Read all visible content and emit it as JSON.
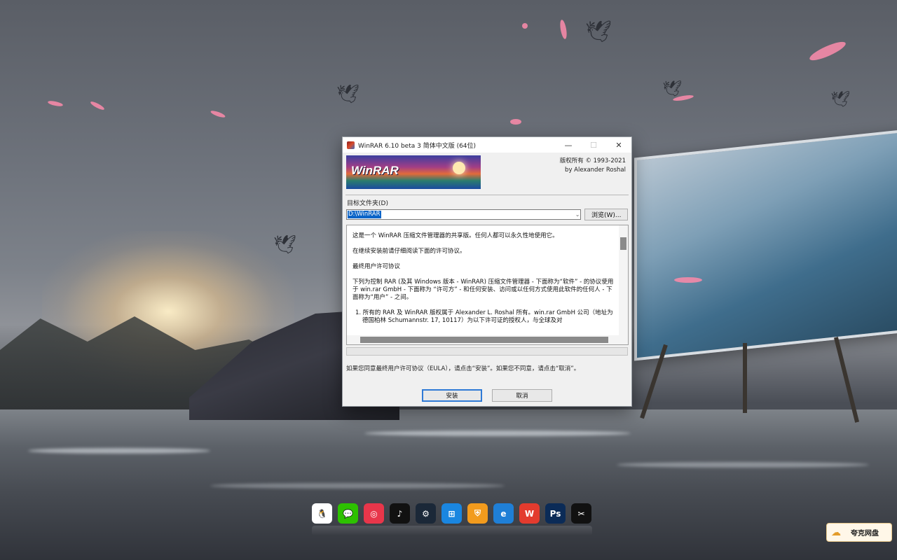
{
  "dialog": {
    "title": "WinRAR 6.10 beta 3 简体中文版 (64位)",
    "buttons": {
      "minimize": "—",
      "maximize": "☐",
      "close": "✕"
    },
    "banner_logo": "WinRAR",
    "copyright_line1": "版权所有 © 1993-2021",
    "copyright_line2": "by Alexander Roshal",
    "folder_label": "目标文件夹(D)",
    "folder_value": "D:\\WinRAR",
    "browse_label": "浏览(W)...",
    "license": {
      "p1": "这是一个 WinRAR 压缩文件管理器的共享版。任何人都可以永久性地使用它。",
      "p2": "在继续安装前请仔细阅读下面的许可协议。",
      "p3": "最终用户许可协议",
      "p4": "下列为控制 RAR (及其 Windows 版本 - WinRAR) 压缩文件管理器 - 下面称为“软件” - 的协议使用于 win.rar GmbH - 下面称为 “许可方” - 和任何安装、访问或以任何方式使用此软件的任何人 - 下面称为“用户” - 之间。",
      "p5": "1.   所有的 RAR 及 WinRAR 版权属于 Alexander L. Roshal 所有。win.rar GmbH 公司（地址为德国柏林 Schumannstr. 17, 10117）为以下许可证的授权人，与全球及对"
    },
    "hint": "如果您同意最终用户许可协议（EULA），请点击“安装”。如果您不同意，请点击“取消”。",
    "install_label": "安装",
    "cancel_label": "取消"
  },
  "taskbar": {
    "icons": [
      {
        "name": "qq-icon",
        "glyph": "🐧",
        "color": "#ffffff"
      },
      {
        "name": "wechat-icon",
        "glyph": "💬",
        "color": "#2dc100"
      },
      {
        "name": "netease-music-icon",
        "glyph": "◎",
        "color": "#e8364a"
      },
      {
        "name": "tiktok-icon",
        "glyph": "♪",
        "color": "#111111"
      },
      {
        "name": "steam-icon",
        "glyph": "⚙",
        "color": "#1b2838"
      },
      {
        "name": "windows-icon",
        "glyph": "⊞",
        "color": "#1a86e0"
      },
      {
        "name": "security-shield-icon",
        "glyph": "⛨",
        "color": "#f29b1d"
      },
      {
        "name": "edge-icon",
        "glyph": "e",
        "color": "#1f7fd6"
      },
      {
        "name": "wps-icon",
        "glyph": "W",
        "color": "#e33b2e"
      },
      {
        "name": "photoshop-icon",
        "glyph": "Ps",
        "color": "#0b2b57"
      },
      {
        "name": "capcut-icon",
        "glyph": "✂",
        "color": "#111111"
      }
    ]
  },
  "cloud_drive": {
    "label": "夸克网盘",
    "icon": "cloud-icon"
  }
}
